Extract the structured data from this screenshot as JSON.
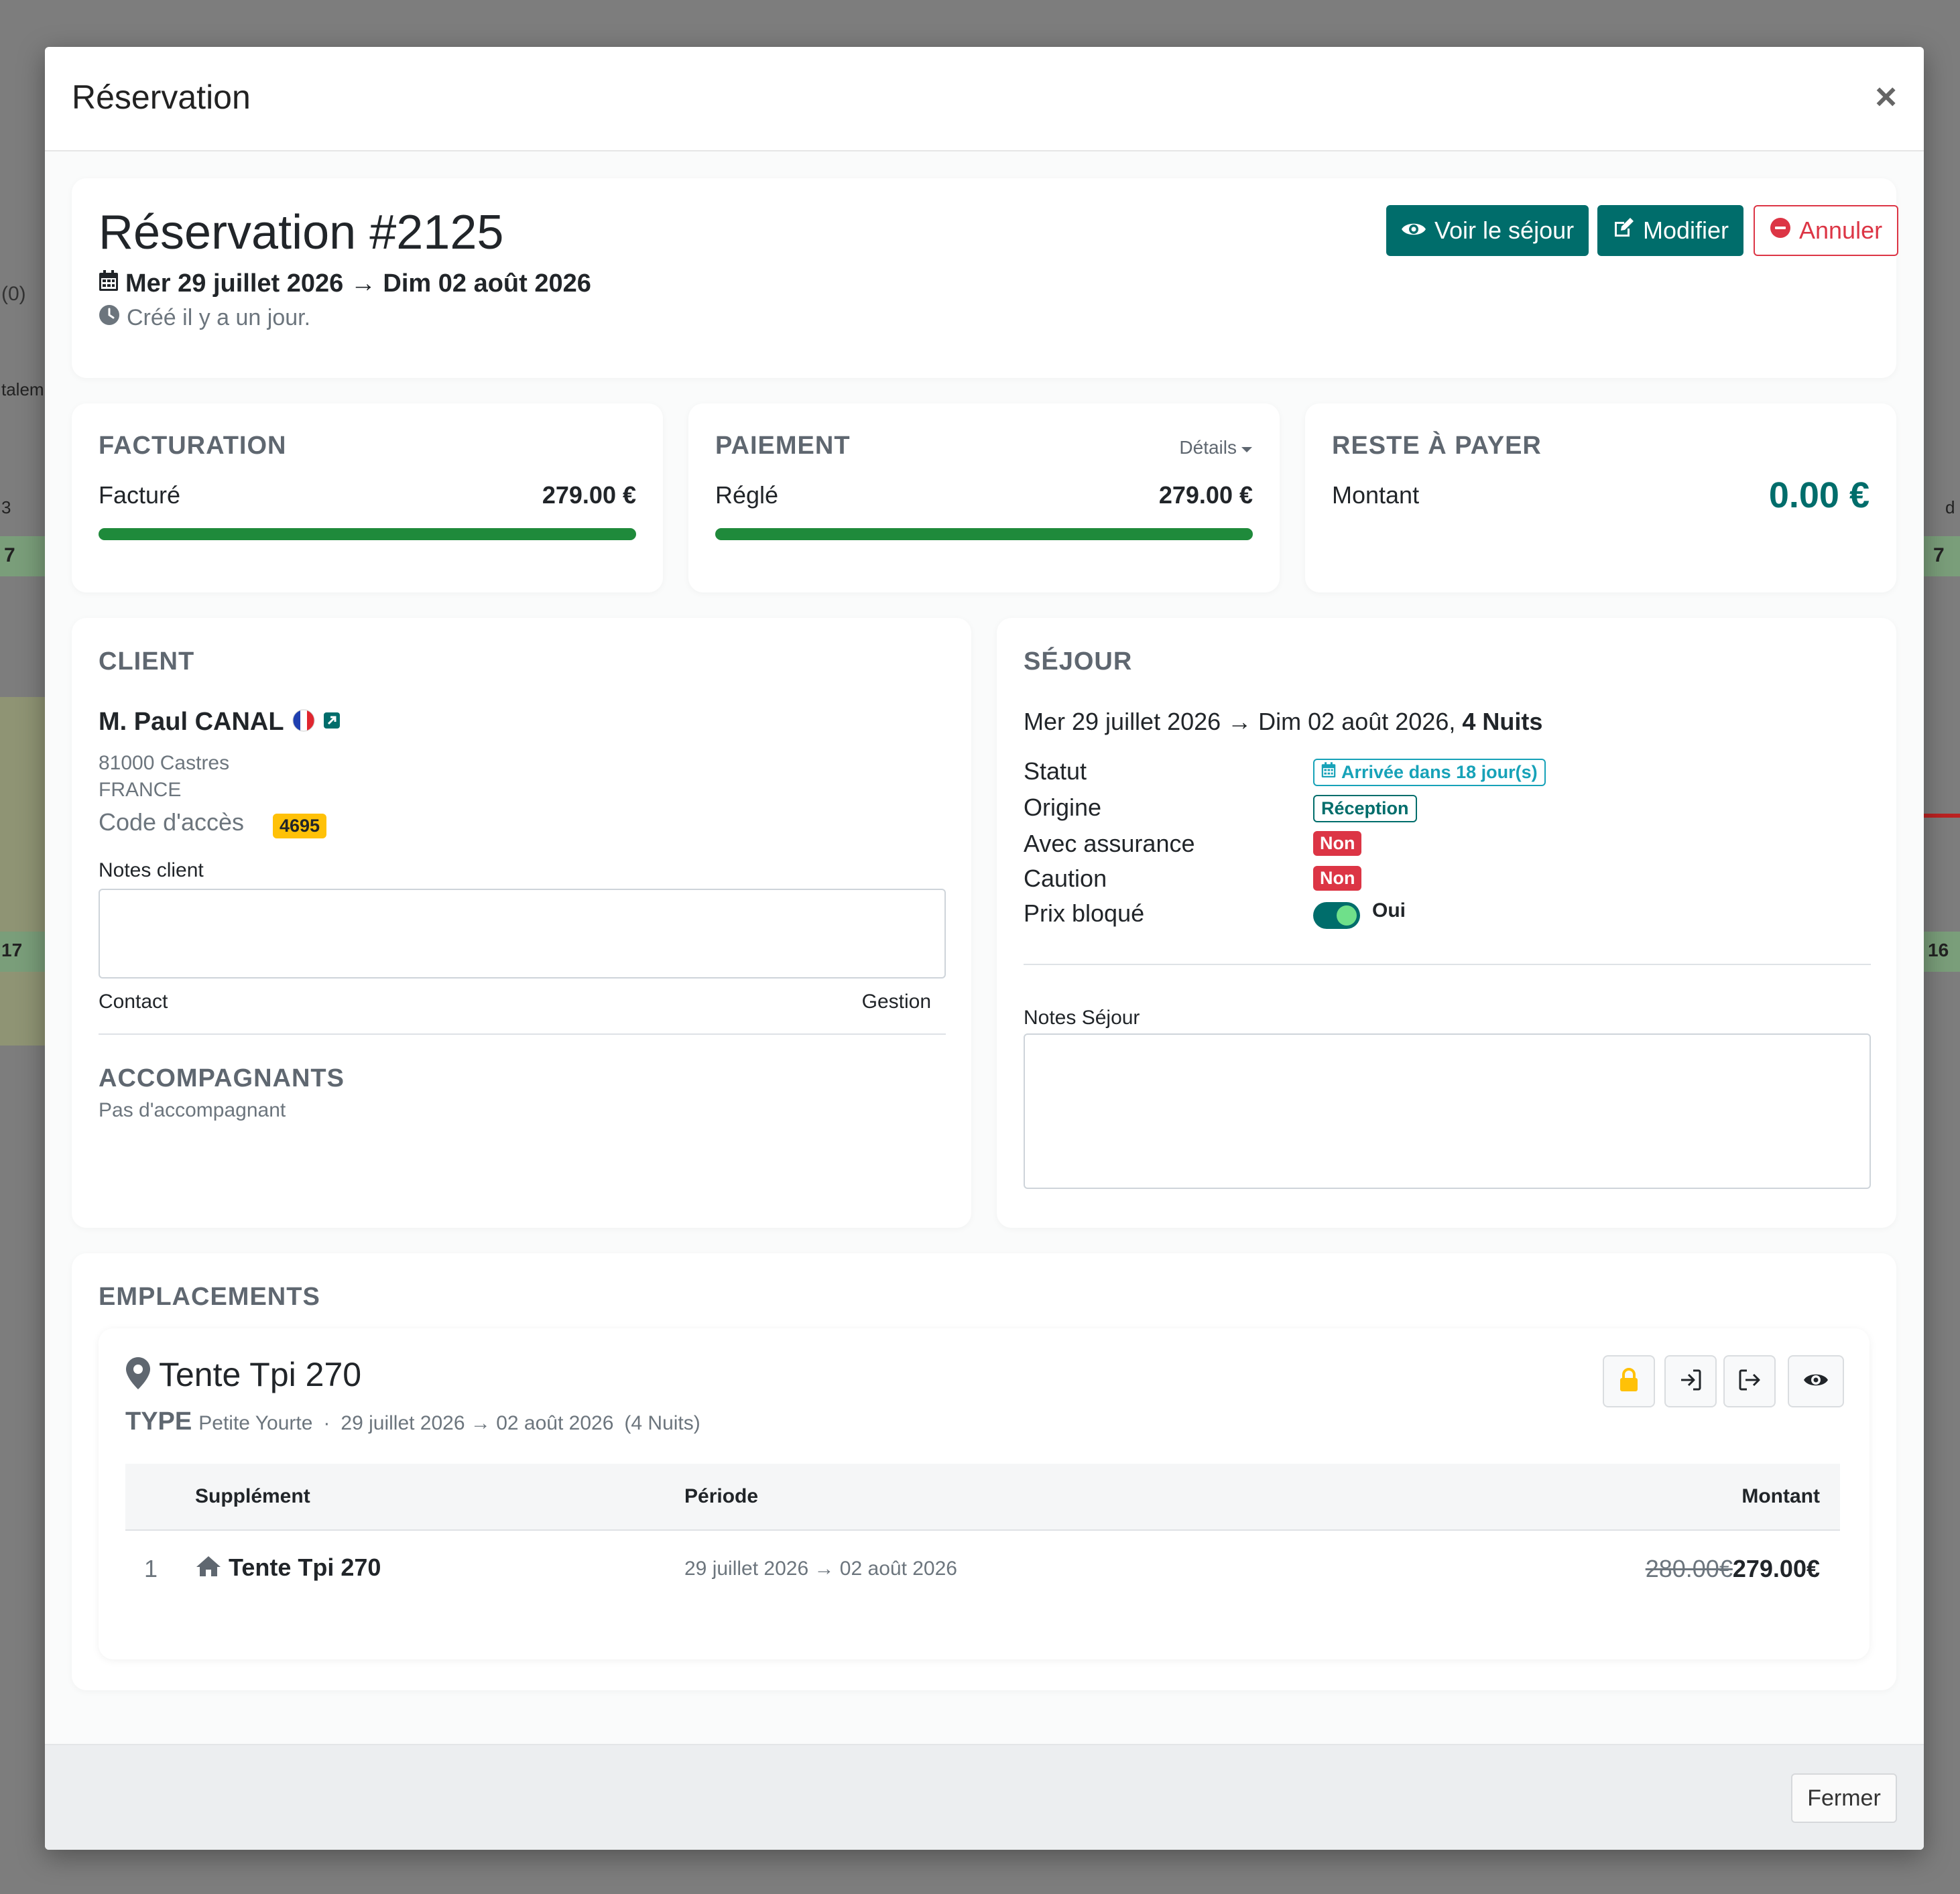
{
  "background": {
    "fragments": [
      "(0)",
      "talem",
      "3",
      "7",
      "7",
      "17",
      "d",
      "16"
    ]
  },
  "modal": {
    "title": "Réservation",
    "close_glyph": "×",
    "footer_close_label": "Fermer"
  },
  "header_card": {
    "title": "Réservation #2125",
    "dates": "Mer 29 juillet 2026 → Dim 02 août 2026",
    "created": "Créé il y a un jour.",
    "buttons": {
      "view_stay": "Voir le séjour",
      "edit": "Modifier",
      "cancel": "Annuler"
    }
  },
  "facturation": {
    "title": "FACTURATION",
    "label": "Facturé",
    "amount": "279.00 €",
    "progress": 1.0
  },
  "paiement": {
    "title": "PAIEMENT",
    "details_label": "Détails",
    "label": "Réglé",
    "amount": "279.00 €",
    "progress": 1.0
  },
  "reste": {
    "title": "RESTE À PAYER",
    "label": "Montant",
    "amount": "0.00 €"
  },
  "client": {
    "title": "CLIENT",
    "name": "M. Paul CANAL",
    "address_line1": "81000 Castres",
    "address_line2": "FRANCE",
    "access_code_label": "Code d'accès",
    "access_code": "4695",
    "notes_label": "Notes client",
    "contact_label": "Contact",
    "gestion_label": "Gestion",
    "companions_title": "ACCOMPAGNANTS",
    "companions_empty": "Pas d'accompagnant"
  },
  "sejour": {
    "title": "SÉJOUR",
    "dates": "Mer 29 juillet 2026 → Dim 02 août 2026,",
    "nights": "4 Nuits",
    "rows": [
      {
        "label": "Statut",
        "value": "Arrivée dans 18 jour(s)"
      },
      {
        "label": "Origine",
        "value": "Réception"
      },
      {
        "label": "Avec assurance",
        "value": "Non"
      },
      {
        "label": "Caution",
        "value": "Non"
      },
      {
        "label": "Prix bloqué",
        "value": "Oui"
      }
    ],
    "notes_label": "Notes Séjour"
  },
  "emplacements": {
    "title": "EMPLACEMENTS",
    "site_name": "Tente Tpi 270",
    "type_label": "TYPE",
    "type_value": "Petite Yourte",
    "sep": "·",
    "period": "29 juillet 2026 → 02 août 2026",
    "nights": "(4 Nuits)",
    "table": {
      "headers": [
        "Supplément",
        "Période",
        "Montant"
      ],
      "rows": [
        {
          "index": "1",
          "name": "Tente Tpi 270",
          "period": "29 juillet 2026 → 02 août 2026",
          "old_price": "280.00€",
          "price": "279.00€"
        }
      ]
    }
  },
  "colors": {
    "teal": "#006d6b",
    "green": "#1f8a3b",
    "red": "#dc3545",
    "yellow": "#ffc107",
    "cyan": "#17a2b8"
  }
}
